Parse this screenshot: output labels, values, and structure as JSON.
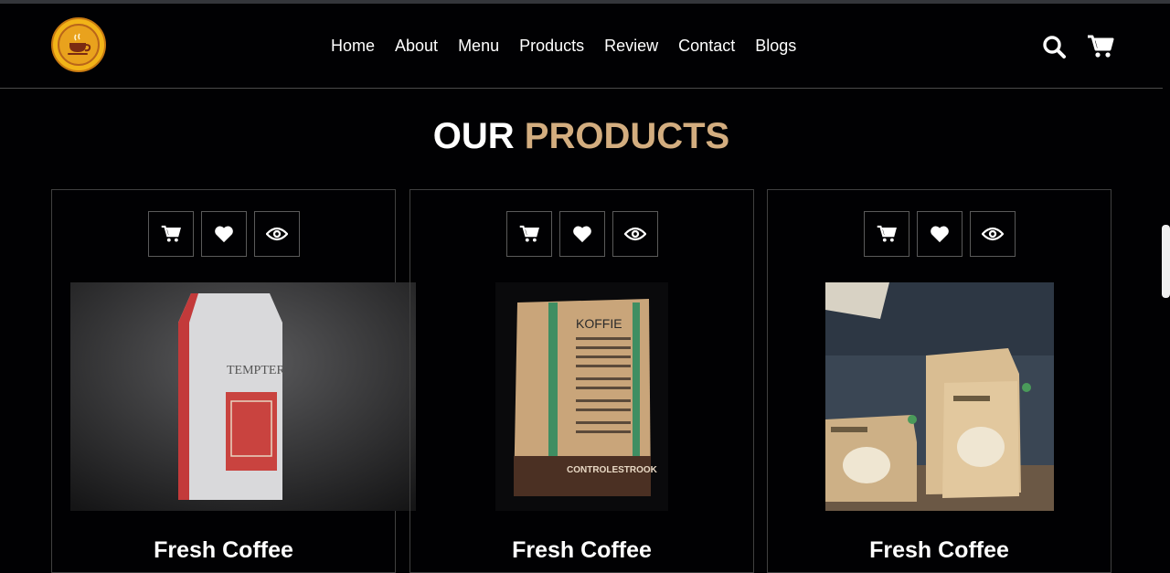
{
  "nav": {
    "items": [
      {
        "label": "Home"
      },
      {
        "label": "About"
      },
      {
        "label": "Menu"
      },
      {
        "label": "Products"
      },
      {
        "label": "Review"
      },
      {
        "label": "Contact"
      },
      {
        "label": "Blogs"
      }
    ]
  },
  "header_icons": [
    "search-icon",
    "cart-icon"
  ],
  "section": {
    "title_plain": "OUR",
    "title_accent": "PRODUCTS"
  },
  "colors": {
    "background": "#010103",
    "accent": "#d3ad7f",
    "logo": "#f2b418"
  },
  "products": [
    {
      "name": "Fresh Coffee",
      "image": "Tempter coffee bag",
      "actions": [
        "cart-icon",
        "heart-icon",
        "eye-icon"
      ]
    },
    {
      "name": "Fresh Coffee",
      "image": "Koffie paper bag",
      "actions": [
        "cart-icon",
        "heart-icon",
        "eye-icon"
      ]
    },
    {
      "name": "Fresh Coffee",
      "image": "coffee pouches display",
      "actions": [
        "cart-icon",
        "heart-icon",
        "eye-icon"
      ]
    }
  ]
}
